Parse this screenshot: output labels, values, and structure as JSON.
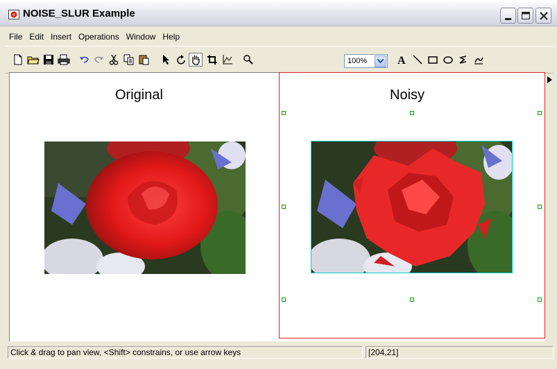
{
  "window": {
    "title": "NOISE_SLUR Example"
  },
  "menu": [
    "File",
    "Edit",
    "Insert",
    "Operations",
    "Window",
    "Help"
  ],
  "toolbar": {
    "zoom_value": "100%",
    "tools": [
      "new-file-icon",
      "open-folder-icon",
      "save-icon",
      "print-icon",
      "undo-icon",
      "redo-icon",
      "cut-icon",
      "copy-icon",
      "paste-icon",
      "select-arrow-icon",
      "rotate-icon",
      "pan-hand-icon",
      "crop-icon",
      "data-cursor-icon",
      "zoom-icon",
      "text-icon",
      "line-icon",
      "rectangle-icon",
      "ellipse-icon",
      "freeform-icon",
      "arrow-tool-icon"
    ]
  },
  "figure": {
    "left_title": "Original",
    "right_title": "Noisy"
  },
  "status": {
    "message": "Click & drag to pan view, <Shift> constrains, or use arrow keys",
    "coordinates": "[204,21]"
  },
  "colors": {
    "selection": "#e02020",
    "image_highlight": "#00d0d0",
    "handle": "#00a000"
  }
}
